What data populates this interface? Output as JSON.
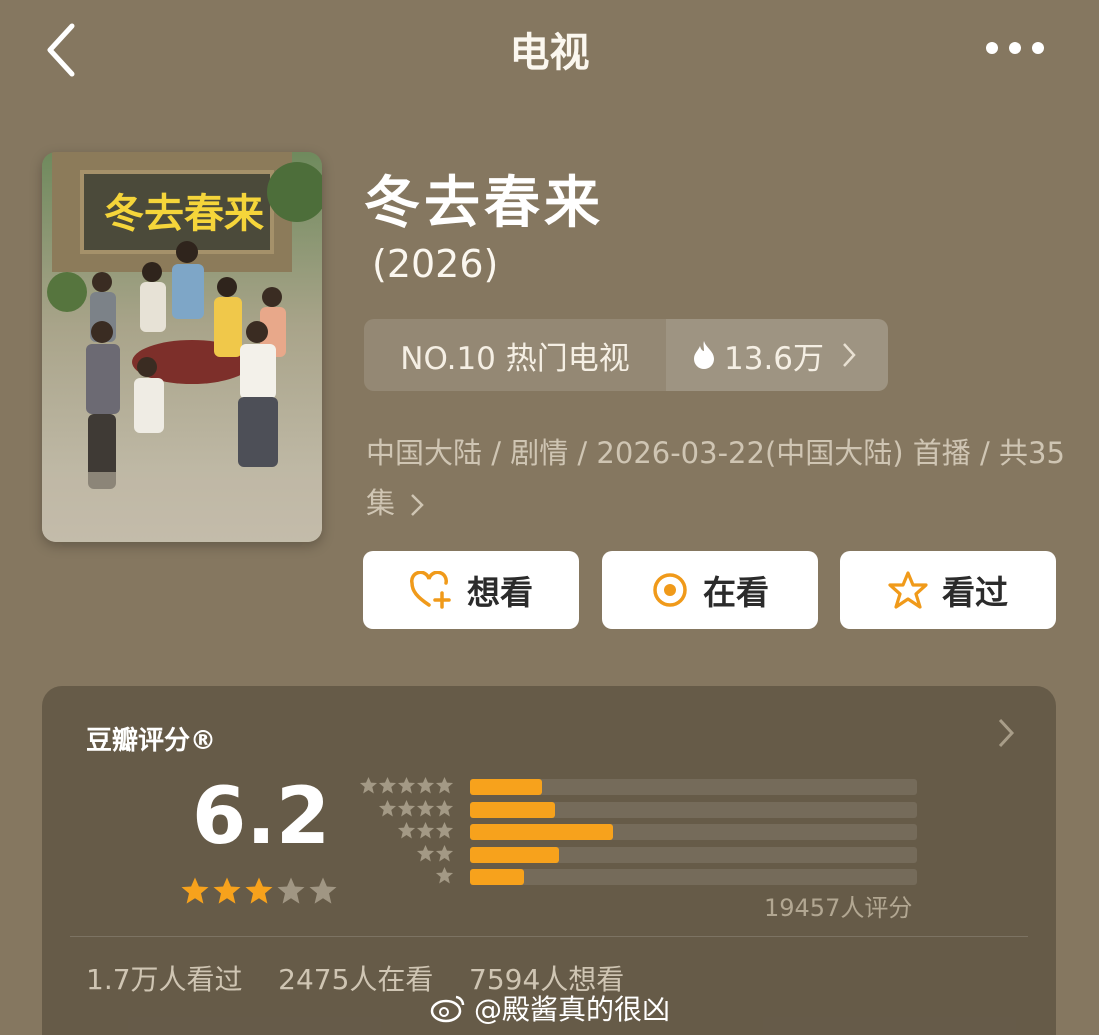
{
  "nav": {
    "title": "电视",
    "back_icon": "chevron-left-icon",
    "more_icon": "more-dots-icon"
  },
  "show": {
    "title": "冬去春来",
    "year": "(2026)",
    "poster_title": "冬去春来",
    "rank_label": "NO.10 热门电视",
    "hot_count": "13.6万",
    "meta": "中国大陆 / 剧情 / 2026-03-22(中国大陆) 首播 / 共35集"
  },
  "actions": [
    {
      "label": "想看",
      "icon": "heart-plus-icon"
    },
    {
      "label": "在看",
      "icon": "target-icon"
    },
    {
      "label": "看过",
      "icon": "star-outline-icon"
    }
  ],
  "rating": {
    "title": "豆瓣评分®",
    "score": "6.2",
    "stars_out_of_5": 3,
    "distribution_fraction": [
      0.16,
      0.19,
      0.32,
      0.2,
      0.12
    ],
    "distribution_labels": [
      "5 stars",
      "4 stars",
      "3 stars",
      "2 stars",
      "1 star"
    ],
    "count_label": "19457人评分",
    "stats": [
      "1.7万人看过",
      "2475人在看",
      "7594人想看"
    ]
  },
  "colors": {
    "accent": "#f7a21c",
    "background": "#857760",
    "button_bg": "#ffffff"
  },
  "watermark": "@殿酱真的很凶"
}
